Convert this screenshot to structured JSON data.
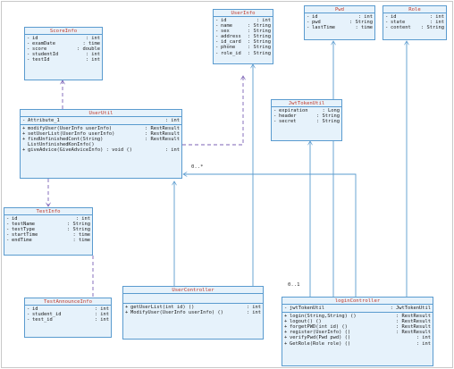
{
  "classes": {
    "score_info": {
      "name": "ScoreInfo",
      "attributes": [
        {
          "v": "-",
          "n": "id",
          "t": ": int"
        },
        {
          "v": "-",
          "n": "examDate",
          "t": ": time"
        },
        {
          "v": "-",
          "n": "score",
          "t": ": double"
        },
        {
          "v": "-",
          "n": "studentId",
          "t": ": int"
        },
        {
          "v": "-",
          "n": "testId",
          "t": ": int"
        }
      ],
      "operations": []
    },
    "user_info": {
      "name": "UserInfo",
      "attributes": [
        {
          "v": "-",
          "n": "id",
          "t": ": int"
        },
        {
          "v": "-",
          "n": "name",
          "t": ": String"
        },
        {
          "v": "-",
          "n": "sex",
          "t": ": String"
        },
        {
          "v": "-",
          "n": "address",
          "t": ": String"
        },
        {
          "v": "-",
          "n": "id_card",
          "t": ": String"
        },
        {
          "v": "-",
          "n": "phone",
          "t": ": String"
        },
        {
          "v": "-",
          "n": "role_id",
          "t": ": String"
        }
      ],
      "operations": []
    },
    "pwd": {
      "name": "Pwd",
      "attributes": [
        {
          "v": "-",
          "n": "id",
          "t": ": int"
        },
        {
          "v": "-",
          "n": "pwd",
          "t": ": String"
        },
        {
          "v": "-",
          "n": "lastTime",
          "t": ": time"
        }
      ],
      "operations": []
    },
    "role": {
      "name": "Role",
      "attributes": [
        {
          "v": "-",
          "n": "id",
          "t": ": int"
        },
        {
          "v": "-",
          "n": "state",
          "t": ": int"
        },
        {
          "v": "-",
          "n": "content",
          "t": ": String"
        }
      ],
      "operations": []
    },
    "jwt_token_util": {
      "name": "JwtTokenUtil",
      "attributes": [
        {
          "v": "-",
          "n": "expiration",
          "t": ": Long"
        },
        {
          "v": "-",
          "n": "header",
          "t": ": String"
        },
        {
          "v": "-",
          "n": "secret",
          "t": ": String"
        }
      ],
      "operations": []
    },
    "user_util": {
      "name": "UserUtil",
      "attributes": [
        {
          "v": "-",
          "n": "Attribute_1",
          "t": ": int"
        }
      ],
      "operations": [
        {
          "v": "+",
          "n": "modifyUser(UserInfo userInfo)",
          "t": ": RestResult"
        },
        {
          "v": "+",
          "n": "setUserList(UserInfo userInfo)",
          "t": ": RestResult"
        },
        {
          "v": "+",
          "n": "findUnfinishedCont(String)",
          "t": ": RestResult"
        },
        {
          "v": "",
          "n": "ListUnfinishedKonInfo()",
          "t": ""
        },
        {
          "v": "+",
          "n": "giveAdvice(GiveAdviceInfo) : void ()",
          "t": ": int"
        }
      ]
    },
    "test_info": {
      "name": "TestInfo",
      "attributes": [
        {
          "v": "-",
          "n": "id",
          "t": ": int"
        },
        {
          "v": "-",
          "n": "testName",
          "t": ": String"
        },
        {
          "v": "-",
          "n": "testType",
          "t": ": String"
        },
        {
          "v": "-",
          "n": "startTime",
          "t": ": time"
        },
        {
          "v": "-",
          "n": "endTime",
          "t": ": time"
        }
      ],
      "operations": []
    },
    "test_announce_info": {
      "name": "TestAnnounceInfo",
      "attributes": [
        {
          "v": "-",
          "n": "id",
          "t": ": int"
        },
        {
          "v": "-",
          "n": "student_id",
          "t": ": int"
        },
        {
          "v": "-",
          "n": "test_id",
          "t": ": int"
        }
      ],
      "operations": []
    },
    "user_controller": {
      "name": "UserController",
      "attributes": [],
      "operations": [
        {
          "v": "+",
          "n": "getUserList(int id) ()",
          "t": ": int"
        },
        {
          "v": "+",
          "n": "ModifyUser(UserInfo userInfo) ()",
          "t": ": int"
        }
      ]
    },
    "login_controller": {
      "name": "loginController",
      "attributes": [
        {
          "v": "-",
          "n": "jwtTokenUtil",
          "t": ": JwtTokenUtil"
        }
      ],
      "operations": [
        {
          "v": "+",
          "n": "login(String,String) ()",
          "t": ": RestResult"
        },
        {
          "v": "+",
          "n": "logout() ()",
          "t": ": RestResult"
        },
        {
          "v": "+",
          "n": "forgetPWD(int id) ()",
          "t": ": RestResult"
        },
        {
          "v": "+",
          "n": "register(UserInfo) ()",
          "t": ": RestResult"
        },
        {
          "v": "+",
          "n": "verifyPwd(Pwd pwd) ()",
          "t": ": int"
        },
        {
          "v": "+",
          "n": "GetRole(Role role) ()",
          "t": ": int"
        }
      ]
    }
  },
  "multiplicities": {
    "user_util_assoc_many": "0..*",
    "login_jwt_assoc_one": "0..1"
  },
  "colors": {
    "class_fill": "#e6f2fb",
    "class_border": "#5a9bcf",
    "class_name": "#c0392b",
    "dependency": "#7b61b5",
    "association": "#5a9bcf"
  }
}
